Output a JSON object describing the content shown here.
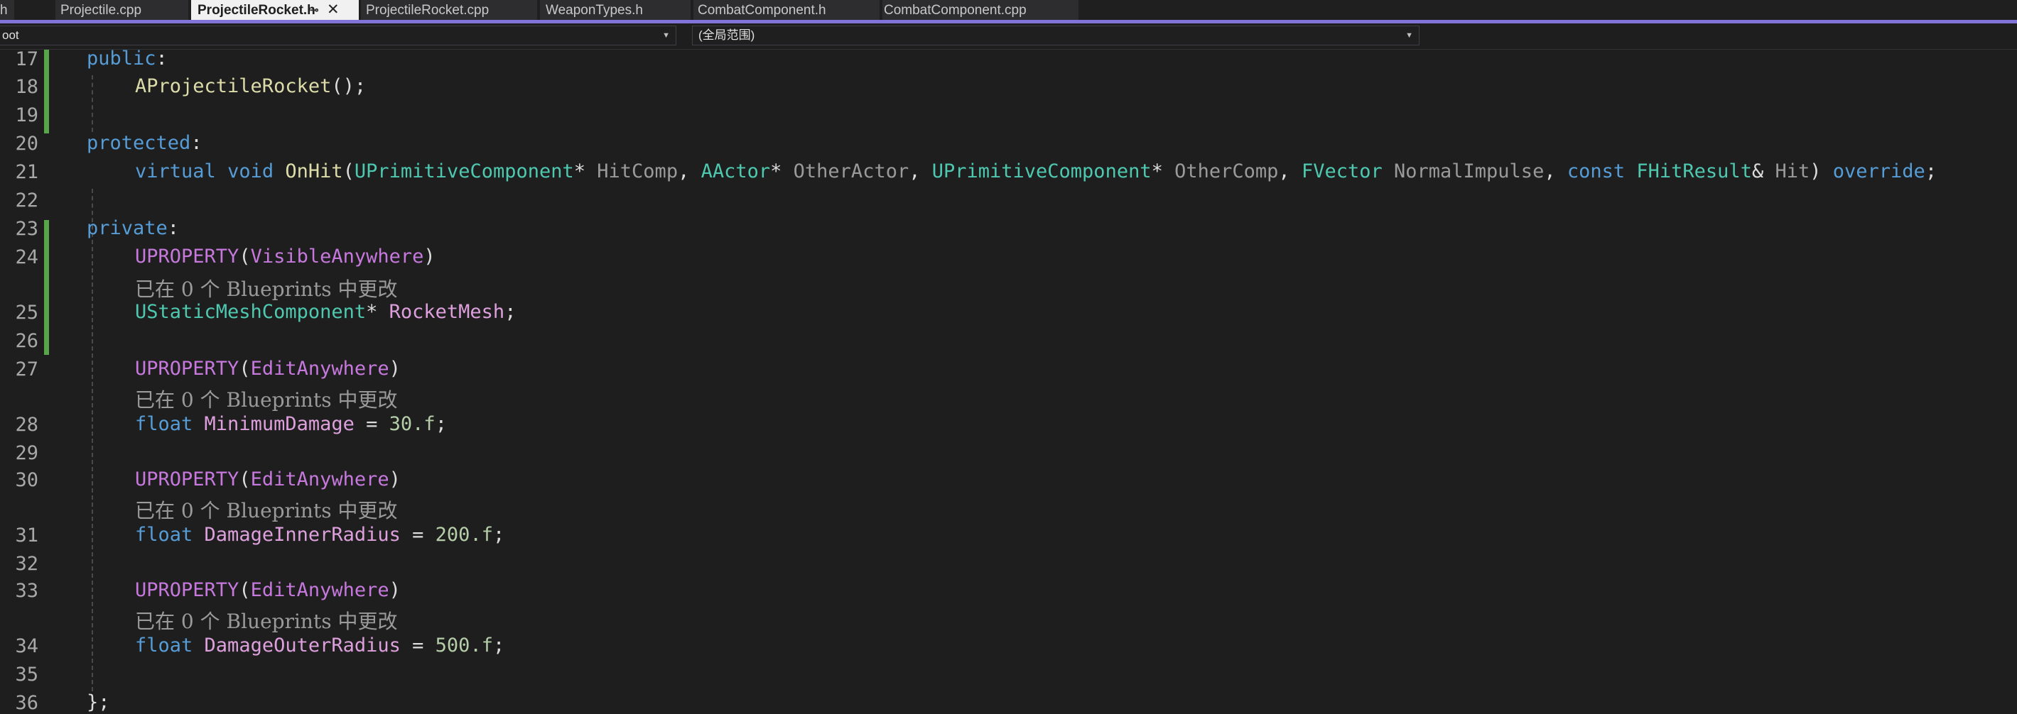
{
  "tabs": [
    {
      "label": "h"
    },
    {
      "label": "Projectile.cpp"
    },
    {
      "label": "ProjectileRocket.h",
      "active": true
    },
    {
      "label": "ProjectileRocket.cpp"
    },
    {
      "label": "WeaponTypes.h"
    },
    {
      "label": "CombatComponent.h"
    },
    {
      "label": "CombatComponent.cpp"
    }
  ],
  "nav": {
    "project": "oot",
    "scope": "(全局范围)"
  },
  "hint_text": "已在 0 个 Blueprints 中更改",
  "lines": [
    {
      "num": "17",
      "tokens": [
        [
          "kw",
          "public"
        ],
        [
          "pl",
          ":"
        ]
      ]
    },
    {
      "num": "18",
      "tokens": [
        [
          "fn",
          "AProjectileRocket"
        ],
        [
          "pl",
          "();"
        ]
      ]
    },
    {
      "num": "19",
      "tokens": []
    },
    {
      "num": "20",
      "tokens": [
        [
          "kw",
          "protected"
        ],
        [
          "pl",
          ":"
        ]
      ]
    },
    {
      "num": "21",
      "tokens": [
        [
          "kw",
          "virtual"
        ],
        [
          "pl",
          " "
        ],
        [
          "kw",
          "void"
        ],
        [
          "pl",
          " "
        ],
        [
          "fn",
          "OnHit"
        ],
        [
          "pl",
          "("
        ],
        [
          "ty",
          "UPrimitiveComponent"
        ],
        [
          "pl",
          "* "
        ],
        [
          "prm",
          "HitComp"
        ],
        [
          "pl",
          ", "
        ],
        [
          "ty",
          "AActor"
        ],
        [
          "pl",
          "* "
        ],
        [
          "prm",
          "OtherActor"
        ],
        [
          "pl",
          ", "
        ],
        [
          "ty",
          "UPrimitiveComponent"
        ],
        [
          "pl",
          "* "
        ],
        [
          "prm",
          "OtherComp"
        ],
        [
          "pl",
          ", "
        ],
        [
          "ty",
          "FVector"
        ],
        [
          "pl",
          " "
        ],
        [
          "prm",
          "NormalImpulse"
        ],
        [
          "pl",
          ", "
        ],
        [
          "kw",
          "const"
        ],
        [
          "pl",
          " "
        ],
        [
          "ty",
          "FHitResult"
        ],
        [
          "pl",
          "& "
        ],
        [
          "prm",
          "Hit"
        ],
        [
          "pl",
          ") "
        ],
        [
          "kw",
          "override"
        ],
        [
          "pl",
          ";"
        ]
      ]
    },
    {
      "num": "22",
      "tokens": []
    },
    {
      "num": "23",
      "tokens": [
        [
          "kw",
          "private"
        ],
        [
          "pl",
          ":"
        ]
      ]
    },
    {
      "num": "24",
      "tokens": [
        [
          "mac",
          "UPROPERTY"
        ],
        [
          "pl",
          "("
        ],
        [
          "mac",
          "VisibleAnywhere"
        ],
        [
          "pl",
          ")"
        ]
      ]
    },
    {
      "num": "25",
      "tokens": [
        [
          "ty",
          "UStaticMeshComponent"
        ],
        [
          "pl",
          "* "
        ],
        [
          "mem",
          "RocketMesh"
        ],
        [
          "pl",
          ";"
        ]
      ]
    },
    {
      "num": "26",
      "tokens": []
    },
    {
      "num": "27",
      "tokens": [
        [
          "mac",
          "UPROPERTY"
        ],
        [
          "pl",
          "("
        ],
        [
          "mac",
          "EditAnywhere"
        ],
        [
          "pl",
          ")"
        ]
      ]
    },
    {
      "num": "28",
      "tokens": [
        [
          "kw",
          "float"
        ],
        [
          "pl",
          " "
        ],
        [
          "mem",
          "MinimumDamage"
        ],
        [
          "pl",
          " = "
        ],
        [
          "num",
          "30.f"
        ],
        [
          "pl",
          ";"
        ]
      ]
    },
    {
      "num": "29",
      "tokens": []
    },
    {
      "num": "30",
      "tokens": [
        [
          "mac",
          "UPROPERTY"
        ],
        [
          "pl",
          "("
        ],
        [
          "mac",
          "EditAnywhere"
        ],
        [
          "pl",
          ")"
        ]
      ]
    },
    {
      "num": "31",
      "tokens": [
        [
          "kw",
          "float"
        ],
        [
          "pl",
          " "
        ],
        [
          "mem",
          "DamageInnerRadius"
        ],
        [
          "pl",
          " = "
        ],
        [
          "num",
          "200.f"
        ],
        [
          "pl",
          ";"
        ]
      ]
    },
    {
      "num": "32",
      "tokens": []
    },
    {
      "num": "33",
      "tokens": [
        [
          "mac",
          "UPROPERTY"
        ],
        [
          "pl",
          "("
        ],
        [
          "mac",
          "EditAnywhere"
        ],
        [
          "pl",
          ")"
        ]
      ]
    },
    {
      "num": "34",
      "tokens": [
        [
          "kw",
          "float"
        ],
        [
          "pl",
          " "
        ],
        [
          "mem",
          "DamageOuterRadius"
        ],
        [
          "pl",
          " = "
        ],
        [
          "num",
          "500.f"
        ],
        [
          "pl",
          ";"
        ]
      ]
    },
    {
      "num": "35",
      "tokens": []
    },
    {
      "num": "36",
      "tokens": [
        [
          "pl",
          "};"
        ]
      ]
    }
  ],
  "colors": {
    "accent": "#8173d8",
    "change_bar": "#57a64a",
    "keyword": "#569cd6",
    "type": "#4ec9b0",
    "function": "#dcdcaa",
    "macro": "#c678dd",
    "member": "#dda0dd",
    "number": "#b5cea8"
  }
}
